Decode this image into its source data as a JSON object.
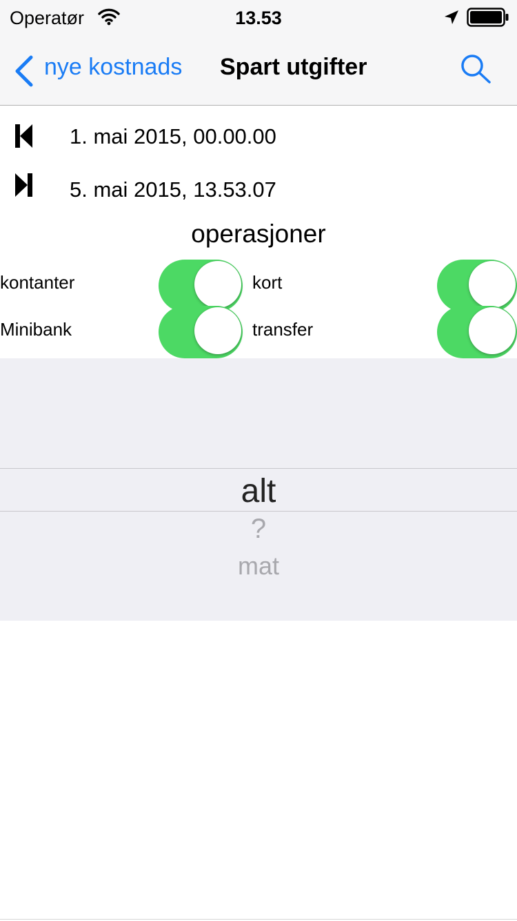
{
  "status_bar": {
    "carrier": "Operatør",
    "time": "13.53"
  },
  "nav": {
    "back_label": "nye kostnads",
    "title": "Spart utgifter",
    "search_icon": "search-icon",
    "accent_color": "#1a7cf5"
  },
  "dates": {
    "start": "1. mai 2015, 00.00.00",
    "end": "5. mai 2015, 13.53.07",
    "start_icon": "skip-to-start-icon",
    "end_icon": "skip-to-end-icon"
  },
  "operations": {
    "title": "operasjoner",
    "toggles": [
      {
        "label": "kontanter",
        "on": true
      },
      {
        "label": "kort",
        "on": true
      },
      {
        "label": "Minibank",
        "on": true
      },
      {
        "label": "transfer",
        "on": true
      }
    ],
    "toggle_color": "#4cd964"
  },
  "picker": {
    "selected": "alt",
    "options": [
      "alt",
      "?",
      "mat"
    ]
  }
}
